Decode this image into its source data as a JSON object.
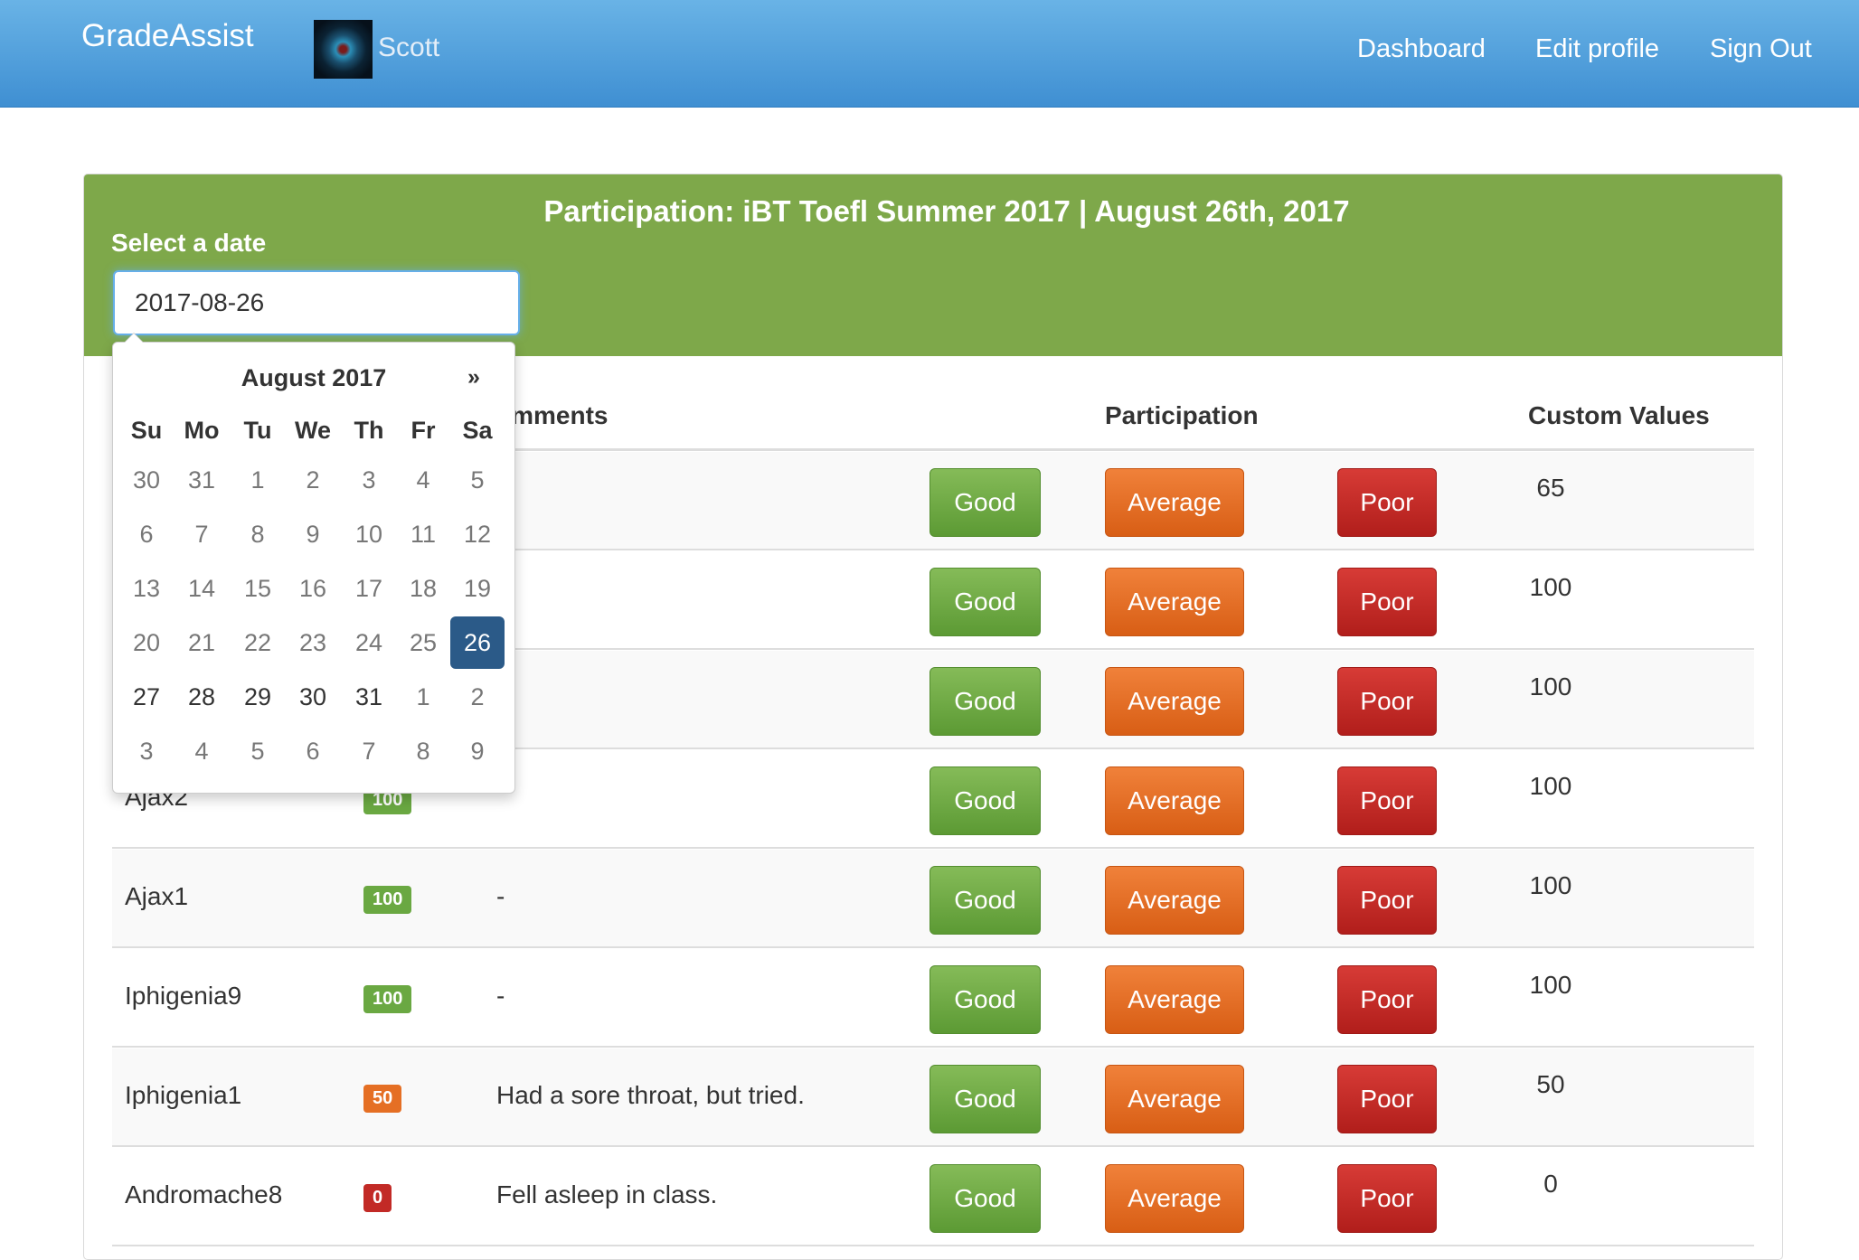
{
  "navbar": {
    "brand": "GradeAssist",
    "user_name": "Scott",
    "links": [
      "Dashboard",
      "Edit profile",
      "Sign Out"
    ]
  },
  "panel": {
    "title": "Participation: iBT Toefl Summer 2017 | August 26th, 2017",
    "date_label": "Select a date",
    "date_value": "2017-08-26"
  },
  "table": {
    "headers": {
      "comments": "omments",
      "participation": "Participation",
      "custom": "Custom Values"
    },
    "button_labels": {
      "good": "Good",
      "average": "Average",
      "poor": "Poor"
    },
    "rows": [
      {
        "name": "",
        "score": "",
        "comment": "",
        "custom": "65"
      },
      {
        "name": "",
        "score": "",
        "comment": "",
        "custom": "100"
      },
      {
        "name": "",
        "score": "",
        "comment": "",
        "custom": "100"
      },
      {
        "name": "Ajax2",
        "score": "100",
        "comment": "",
        "custom": "100"
      },
      {
        "name": "Ajax1",
        "score": "100",
        "comment": "-",
        "custom": "100"
      },
      {
        "name": "Iphigenia9",
        "score": "100",
        "comment": "-",
        "custom": "100"
      },
      {
        "name": "Iphigenia1",
        "score": "50",
        "comment": "Had a sore throat, but tried.",
        "custom": "50"
      },
      {
        "name": "Andromache8",
        "score": "0",
        "comment": "Fell asleep in class.",
        "custom": "0"
      }
    ]
  },
  "colors": {
    "navbar": "#4a9ad9",
    "panel_heading": "#7ea84a",
    "good": "#6aa842",
    "average": "#e56f24",
    "poor": "#c22a26",
    "selected_day": "#2b5a88"
  },
  "datepicker": {
    "title": "August 2017",
    "next_label": "»",
    "weekdays": [
      "Su",
      "Mo",
      "Tu",
      "We",
      "Th",
      "Fr",
      "Sa"
    ],
    "weeks": [
      [
        "30",
        "31",
        "1",
        "2",
        "3",
        "4",
        "5"
      ],
      [
        "6",
        "7",
        "8",
        "9",
        "10",
        "11",
        "12"
      ],
      [
        "13",
        "14",
        "15",
        "16",
        "17",
        "18",
        "19"
      ],
      [
        "20",
        "21",
        "22",
        "23",
        "24",
        "25",
        "26"
      ],
      [
        "27",
        "28",
        "29",
        "30",
        "31",
        "1",
        "2"
      ],
      [
        "3",
        "4",
        "5",
        "6",
        "7",
        "8",
        "9"
      ]
    ],
    "selected": "26"
  }
}
